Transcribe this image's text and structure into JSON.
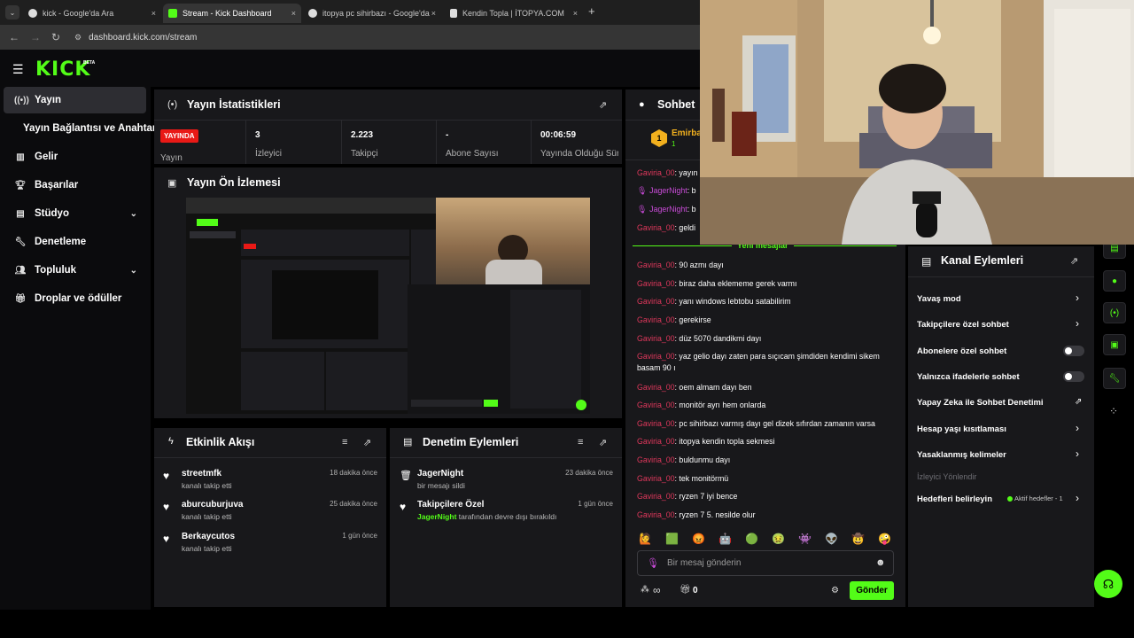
{
  "browser": {
    "tabs": [
      {
        "label": "kick - Google'da Ara",
        "active": false
      },
      {
        "label": "Stream - Kick Dashboard",
        "active": true
      },
      {
        "label": "itopya pc sihirbazı - Google'da",
        "active": false
      },
      {
        "label": "Kendin Topla | İTOPYA.COM",
        "active": false
      }
    ],
    "url": "dashboard.kick.com/stream",
    "close_glyph": "×",
    "newtab_glyph": "+"
  },
  "brand": {
    "logo": "KICK",
    "beta": "BETA",
    "accent": "#53fc18"
  },
  "sidebar": {
    "items": [
      {
        "label": "Yayın",
        "icon": "broadcast-icon"
      },
      {
        "label": "Yayın Bağlantısı ve Anahtarı",
        "icon": ""
      },
      {
        "label": "Gelir",
        "icon": "chart-icon"
      },
      {
        "label": "Başarılar",
        "icon": "trophy-icon"
      },
      {
        "label": "Stüdyo",
        "icon": "studio-icon"
      },
      {
        "label": "Denetleme",
        "icon": "wrench-icon"
      },
      {
        "label": "Topluluk",
        "icon": "people-icon"
      },
      {
        "label": "Droplar ve ödüller",
        "icon": "gift-icon"
      }
    ]
  },
  "stats": {
    "title": "Yayın İstatistikleri",
    "live_badge": "YAYINDA",
    "status_label": "Yayın",
    "items": [
      {
        "value": "3",
        "label": "İzleyici"
      },
      {
        "value": "2.223",
        "label": "Takipçi"
      },
      {
        "value": "-",
        "label": "Abone Sayısı"
      },
      {
        "value": "00:06:59",
        "label": "Yayında Olduğu Süre"
      }
    ]
  },
  "preview": {
    "title": "Yayın Ön İzlemesi"
  },
  "activity": {
    "title": "Etkinlik Akışı",
    "entries": [
      {
        "name": "streetmfk",
        "sub": "kanalı takip etti",
        "time": "18 dakika önce"
      },
      {
        "name": "aburcuburjuva",
        "sub": "kanalı takip etti",
        "time": "25 dakika önce"
      },
      {
        "name": "Berkaycutos",
        "sub": "kanalı takip etti",
        "time": "1 gün önce"
      }
    ]
  },
  "moderation": {
    "title": "Denetim Eylemleri",
    "entries": [
      {
        "name": "JagerNight",
        "sub": "bir mesajı sildi",
        "time": "23 dakika önce"
      },
      {
        "name": "Takipçilere Özel",
        "sub_user": "JagerNight",
        "sub": "tarafından devre dışı bırakıldı",
        "time": "1 gün önce"
      }
    ]
  },
  "chat": {
    "title": "Sohbet",
    "pinned_user": "Emirba",
    "pinned_badge": "1",
    "pinned_count": "1",
    "old_messages": [
      {
        "user": "Gaviria_00",
        "text": ": yayın"
      },
      {
        "user": "JagerNight",
        "text": ": b"
      },
      {
        "user": "JagerNight",
        "text": ": b"
      },
      {
        "user": "Gaviria_00",
        "text": ": geldi"
      }
    ],
    "new_divider": "Yeni mesajlar",
    "messages": [
      {
        "user": "Gaviria_00",
        "text": ": 90 azmı dayı"
      },
      {
        "user": "Gaviria_00",
        "text": ": biraz daha eklememe gerek varmı"
      },
      {
        "user": "Gaviria_00",
        "text": ": yanı windows lebtobu satabilirim"
      },
      {
        "user": "Gaviria_00",
        "text": ": gerekirse"
      },
      {
        "user": "Gaviria_00",
        "text": ": düz 5070 dandikmi dayı"
      },
      {
        "user": "Gaviria_00",
        "text": ": yaz gelio dayı zaten para sıçıcam şimdiden kendimi sikem basam 90 ı"
      },
      {
        "user": "Gaviria_00",
        "text": ": oem almam dayı ben"
      },
      {
        "user": "Gaviria_00",
        "text": ": monitör ayrı hem onlarda"
      },
      {
        "user": "Gaviria_00",
        "text": ": pc sihirbazı varmış dayı gel dizek sıfırdan zamanın varsa"
      },
      {
        "user": "Gaviria_00",
        "text": ": itopya kendin topla sekmesi"
      },
      {
        "user": "Gaviria_00",
        "text": ": buldunmu dayı"
      },
      {
        "user": "Gaviria_00",
        "text": ": tek monitörmü"
      },
      {
        "user": "Gaviria_00",
        "text": ": ryzen 7 iyi bence"
      },
      {
        "user": "Gaviria_00",
        "text": ": ryzen 7 5. nesilde olur"
      }
    ],
    "input_placeholder": "Bir mesaj gönderin",
    "send_label": "Gönder",
    "points_label": "∞",
    "gift_count": "0"
  },
  "channel_actions": {
    "title": "Kanal Eylemleri",
    "items": [
      {
        "label": "Yavaş mod",
        "control": "chevron"
      },
      {
        "label": "Takipçilere özel sohbet",
        "control": "chevron"
      },
      {
        "label": "Abonelere özel sohbet",
        "control": "toggle"
      },
      {
        "label": "Yalnızca ifadelerle sohbet",
        "control": "toggle"
      },
      {
        "label": "Yapay Zeka ile Sohbet Denetimi",
        "control": "external"
      },
      {
        "label": "Hesap yaşı kısıtlaması",
        "control": "chevron"
      },
      {
        "label": "Yasaklanmış kelimeler",
        "control": "chevron"
      }
    ],
    "section_label": "İzleyici Yönlendir",
    "goals_label": "Hedefleri belirleyin",
    "goals_status": "Aktif hedefler - 1"
  }
}
